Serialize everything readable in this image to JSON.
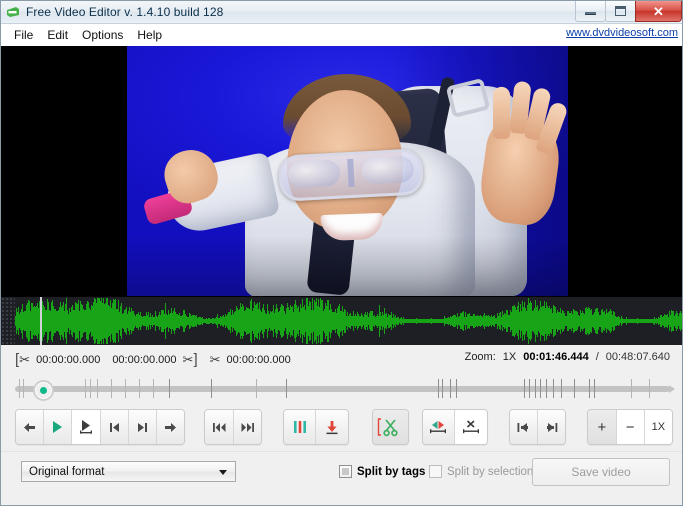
{
  "window": {
    "title": "Free Video Editor v. 1.4.10 build 128",
    "app_icon": "video-editor-icon",
    "minimize_label": "Minimize",
    "maximize_label": "Maximize",
    "close_label": "✕"
  },
  "menu": {
    "items": [
      {
        "label": "File"
      },
      {
        "label": "Edit"
      },
      {
        "label": "Options"
      },
      {
        "label": "Help"
      }
    ],
    "weblink": "www.dvdvideosoft.com"
  },
  "timecodes": {
    "start_label": "00:00:00.000",
    "duration_label": "00:00:00.000",
    "end_label": "00:00:00.000",
    "zoom_label": "Zoom:",
    "zoom_value": "1X",
    "current_time": "00:01:46.444",
    "separator": "/",
    "total_time": "00:48:07.640"
  },
  "transport": {
    "group1": [
      {
        "name": "step-back-button",
        "icon": "arrow-left-icon",
        "glyph": "←"
      },
      {
        "name": "play-button",
        "icon": "play-icon",
        "glyph": "▶"
      },
      {
        "name": "play-selection-button",
        "icon": "play-selection-icon",
        "glyph": "▶"
      },
      {
        "name": "prev-frame-button",
        "icon": "skip-prev-icon",
        "glyph": "⏮"
      },
      {
        "name": "next-frame-button",
        "icon": "skip-next-icon",
        "glyph": "⏭"
      },
      {
        "name": "step-forward-button",
        "icon": "arrow-right-icon",
        "glyph": "→"
      }
    ],
    "group2": [
      {
        "name": "jump-start-button",
        "icon": "rewind-start-icon",
        "glyph": "⏮"
      },
      {
        "name": "jump-end-button",
        "icon": "forward-end-icon",
        "glyph": "⏭"
      }
    ],
    "group3": [
      {
        "name": "markers-button",
        "icon": "three-bars-icon"
      },
      {
        "name": "insert-marker-button",
        "icon": "down-arrow-to-line-icon"
      }
    ],
    "group4": [
      {
        "name": "cut-selection-button",
        "icon": "scissors-icon"
      }
    ],
    "group5": [
      {
        "name": "select-region-button",
        "icon": "select-region-icon"
      },
      {
        "name": "delete-region-button",
        "icon": "delete-region-icon"
      }
    ],
    "group6": [
      {
        "name": "goto-selection-start-button",
        "icon": "to-start-icon"
      },
      {
        "name": "goto-selection-end-button",
        "icon": "to-end-icon"
      }
    ],
    "group7": [
      {
        "name": "zoom-in-button",
        "icon": "plus-icon",
        "label": "+"
      },
      {
        "name": "zoom-out-button",
        "icon": "minus-icon",
        "label": "−"
      },
      {
        "name": "zoom-reset-button",
        "icon": "zoom-reset-icon",
        "label": "1X"
      }
    ]
  },
  "bottom": {
    "format_value": "Original format",
    "split_by_tags_label": "Split by tags",
    "split_by_tags_checked": true,
    "split_by_selections_label": "Split by selections",
    "split_by_selections_checked": false,
    "save_video_label": "Save video"
  },
  "colors": {
    "waveform_green": "#17a417",
    "play_teal": "#17a87c",
    "accent_red": "#e2453c",
    "link_blue": "#0b3fa8",
    "titlebar": "#e8eef3",
    "panel_bg": "#f0f0f0",
    "video_sky_blue": "#1a18d8"
  }
}
